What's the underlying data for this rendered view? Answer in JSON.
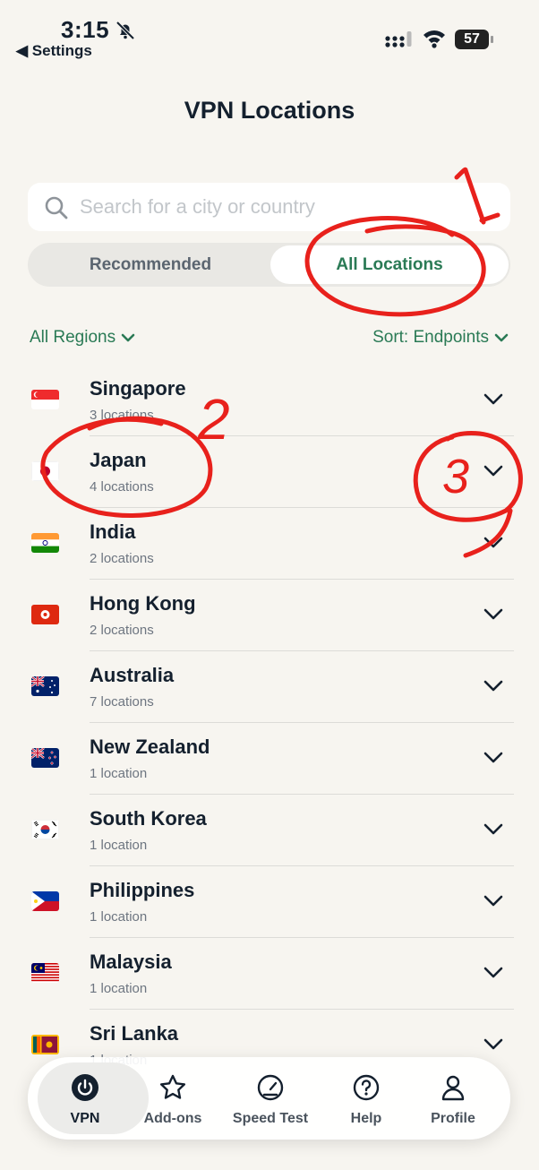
{
  "status": {
    "time": "3:15",
    "back_label": "◀ Settings",
    "battery": "57"
  },
  "header": {
    "title": "VPN Locations"
  },
  "search": {
    "placeholder": "Search for a city or country"
  },
  "segments": {
    "recommended": "Recommended",
    "all_locations": "All Locations",
    "selected": "All Locations"
  },
  "filters": {
    "regions": "All Regions",
    "sort": "Sort: Endpoints"
  },
  "locations": [
    {
      "name": "Singapore",
      "count": "3 locations",
      "flag": "singapore-flag"
    },
    {
      "name": "Japan",
      "count": "4 locations",
      "flag": "japan-flag"
    },
    {
      "name": "India",
      "count": "2 locations",
      "flag": "india-flag"
    },
    {
      "name": "Hong Kong",
      "count": "2 locations",
      "flag": "hong-kong-flag"
    },
    {
      "name": "Australia",
      "count": "7 locations",
      "flag": "australia-flag"
    },
    {
      "name": "New Zealand",
      "count": "1 location",
      "flag": "new-zealand-flag"
    },
    {
      "name": "South Korea",
      "count": "1 location",
      "flag": "south-korea-flag"
    },
    {
      "name": "Philippines",
      "count": "1 location",
      "flag": "philippines-flag"
    },
    {
      "name": "Malaysia",
      "count": "1 location",
      "flag": "malaysia-flag"
    },
    {
      "name": "Sri Lanka",
      "count": "1 location",
      "flag": "sri-lanka-flag"
    }
  ],
  "tabbar": {
    "vpn": "VPN",
    "addons": "Add-ons",
    "speedtest": "Speed Test",
    "help": "Help",
    "profile": "Profile"
  },
  "annotations": {
    "one": "1",
    "two": "2",
    "three": "3"
  },
  "colors": {
    "accent_green": "#2a7a55",
    "text_dark": "#14202e",
    "background": "#f7f5f0",
    "annotation_red": "#e8211c"
  }
}
